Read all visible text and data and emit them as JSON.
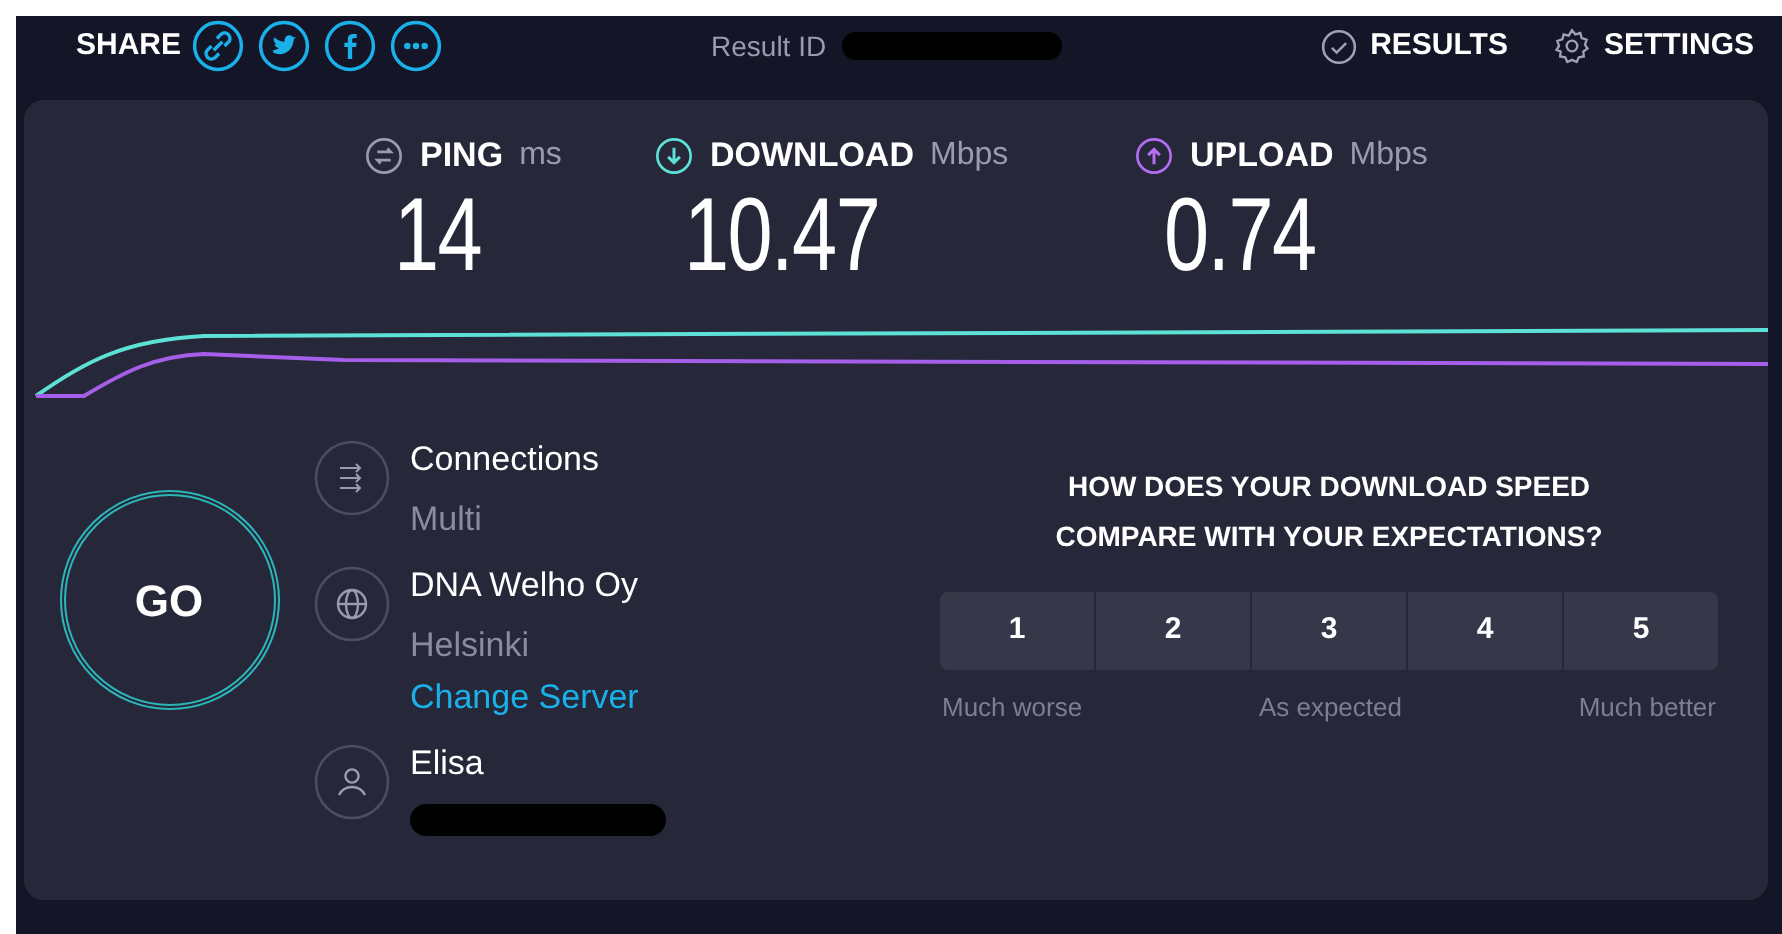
{
  "header": {
    "share_label": "SHARE",
    "share_buttons": [
      {
        "kind": "link"
      },
      {
        "kind": "twitter"
      },
      {
        "kind": "facebook"
      },
      {
        "kind": "more"
      }
    ],
    "result_label": "Result ID",
    "nav": [
      {
        "kind": "results",
        "label": "RESULTS"
      },
      {
        "kind": "settings",
        "label": "SETTINGS"
      }
    ]
  },
  "metrics": [
    {
      "kind": "ping",
      "label": "PING",
      "unit": "ms",
      "value": "14"
    },
    {
      "kind": "download",
      "label": "DOWNLOAD",
      "unit": "Mbps",
      "value": "10.47"
    },
    {
      "kind": "upload",
      "label": "UPLOAD",
      "unit": "Mbps",
      "value": "0.74"
    }
  ],
  "go_button": {
    "label": "GO"
  },
  "info": [
    {
      "kind": "connections",
      "title": "Connections",
      "subtitle": "Multi"
    },
    {
      "kind": "server",
      "title": "DNA Welho Oy",
      "subtitle": "Helsinki",
      "link": "Change Server"
    },
    {
      "kind": "provider",
      "title": "Elisa"
    }
  ],
  "survey": {
    "question": "HOW DOES YOUR DOWNLOAD SPEED COMPARE WITH YOUR EXPECTATIONS?",
    "options": [
      {
        "label": "1",
        "selected": false
      },
      {
        "label": "2",
        "selected": false
      },
      {
        "label": "3",
        "selected": false
      },
      {
        "label": "4",
        "selected": false
      },
      {
        "label": "5",
        "selected": false
      }
    ],
    "scale_labels": [
      "Much worse",
      "As expected",
      "Much better"
    ]
  }
}
